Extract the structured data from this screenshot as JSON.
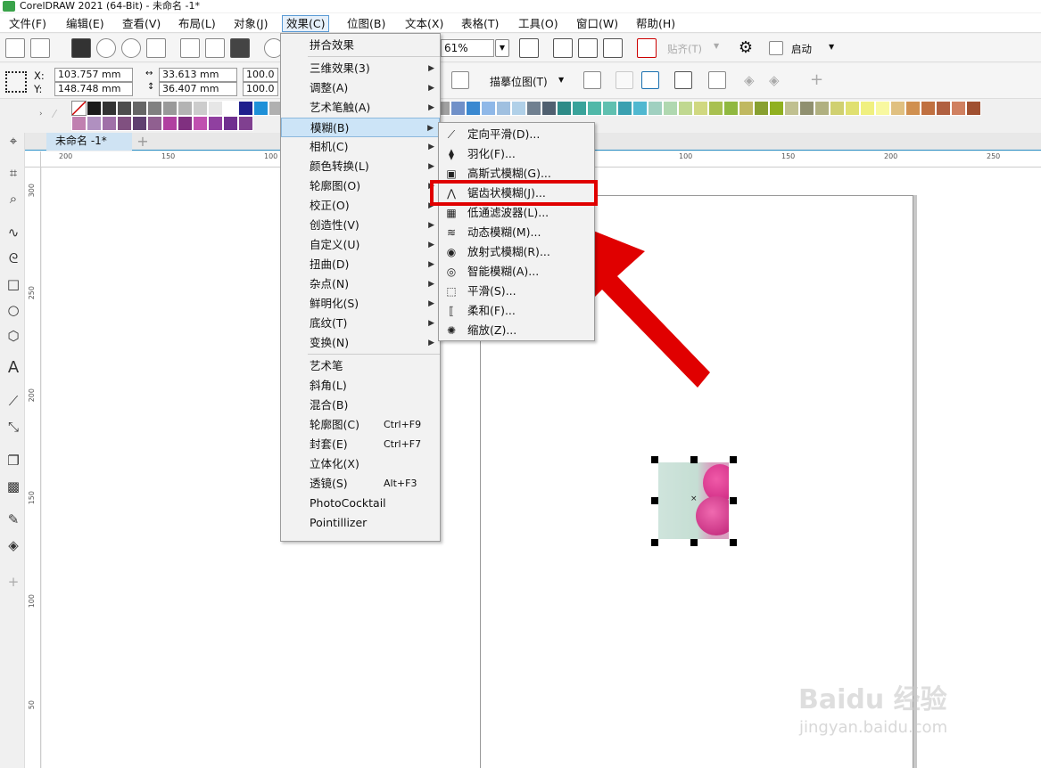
{
  "window": {
    "title": "CorelDRAW 2021 (64-Bit) - 未命名 -1*"
  },
  "menubar": [
    {
      "label": "文件(F)"
    },
    {
      "label": "编辑(E)"
    },
    {
      "label": "查看(V)"
    },
    {
      "label": "布局(L)"
    },
    {
      "label": "对象(J)"
    },
    {
      "label": "效果(C)",
      "active": true
    },
    {
      "label": "位图(B)"
    },
    {
      "label": "文本(X)"
    },
    {
      "label": "表格(T)"
    },
    {
      "label": "工具(O)"
    },
    {
      "label": "窗口(W)"
    },
    {
      "label": "帮助(H)"
    }
  ],
  "toolbar": {
    "zoom": "61%",
    "snap_label": "贴齐(T)",
    "launch_label": "启动"
  },
  "propbar": {
    "x_label": "X:",
    "x_value": "103.757 mm",
    "y_label": "Y:",
    "y_value": "148.748 mm",
    "w_value": "33.613 mm",
    "h_value": "36.407 mm",
    "sx_value": "100.0",
    "sy_value": "100.0",
    "trace_label": "描摹位图(T)"
  },
  "doc_tab": {
    "label": "未命名 -1*"
  },
  "hruler": {
    "labels": [
      "200",
      "150",
      "100",
      "100",
      "150",
      "200",
      "250"
    ]
  },
  "vruler": {
    "labels": [
      "300",
      "250",
      "200",
      "150",
      "100",
      "50"
    ]
  },
  "effects_menu": {
    "items": [
      {
        "label": "拼合效果",
        "submenu": false
      },
      {
        "label": "三维效果(3)",
        "submenu": true
      },
      {
        "label": "调整(A)",
        "submenu": true
      },
      {
        "label": "艺术笔触(A)",
        "submenu": true
      },
      {
        "label": "模糊(B)",
        "submenu": true,
        "highlighted": true
      },
      {
        "label": "相机(C)",
        "submenu": true
      },
      {
        "label": "颜色转换(L)",
        "submenu": true
      },
      {
        "label": "轮廓图(O)",
        "submenu": true
      },
      {
        "label": "校正(O)",
        "submenu": true
      },
      {
        "label": "创造性(V)",
        "submenu": true
      },
      {
        "label": "自定义(U)",
        "submenu": true
      },
      {
        "label": "扭曲(D)",
        "submenu": true
      },
      {
        "label": "杂点(N)",
        "submenu": true
      },
      {
        "label": "鲜明化(S)",
        "submenu": true
      },
      {
        "label": "底纹(T)",
        "submenu": true
      },
      {
        "label": "变换(N)",
        "submenu": true
      },
      {
        "label": "艺术笔",
        "submenu": false
      },
      {
        "label": "斜角(L)",
        "submenu": false
      },
      {
        "label": "混合(B)",
        "submenu": false
      },
      {
        "label": "轮廓图(C)",
        "shortcut": "Ctrl+F9"
      },
      {
        "label": "封套(E)",
        "shortcut": "Ctrl+F7"
      },
      {
        "label": "立体化(X)",
        "submenu": false
      },
      {
        "label": "透镜(S)",
        "shortcut": "Alt+F3"
      },
      {
        "label": "PhotoCocktail",
        "submenu": false
      },
      {
        "label": "Pointillizer",
        "submenu": false
      }
    ]
  },
  "blur_submenu": {
    "items": [
      {
        "label": "定向平滑(D)...",
        "icon": "directional-smooth-icon"
      },
      {
        "label": "羽化(F)...",
        "icon": "feather-icon"
      },
      {
        "label": "高斯式模糊(G)...",
        "icon": "gaussian-blur-icon"
      },
      {
        "label": "锯齿状模糊(J)...",
        "icon": "jaggy-despeckle-icon",
        "boxed": true
      },
      {
        "label": "低通滤波器(L)...",
        "icon": "low-pass-icon"
      },
      {
        "label": "动态模糊(M)...",
        "icon": "motion-blur-icon"
      },
      {
        "label": "放射式模糊(R)...",
        "icon": "radial-blur-icon"
      },
      {
        "label": "智能模糊(A)...",
        "icon": "smart-blur-icon"
      },
      {
        "label": "平滑(S)...",
        "icon": "smooth-icon"
      },
      {
        "label": "柔和(F)...",
        "icon": "soften-icon"
      },
      {
        "label": "缩放(Z)...",
        "icon": "zoom-blur-icon"
      }
    ]
  },
  "colors": {
    "highlight_box": "#e00000",
    "arrow": "#e00000",
    "accent": "#2a90c8"
  },
  "watermark": {
    "brand": "Baidu 经验",
    "url": "jingyan.baidu.com"
  }
}
